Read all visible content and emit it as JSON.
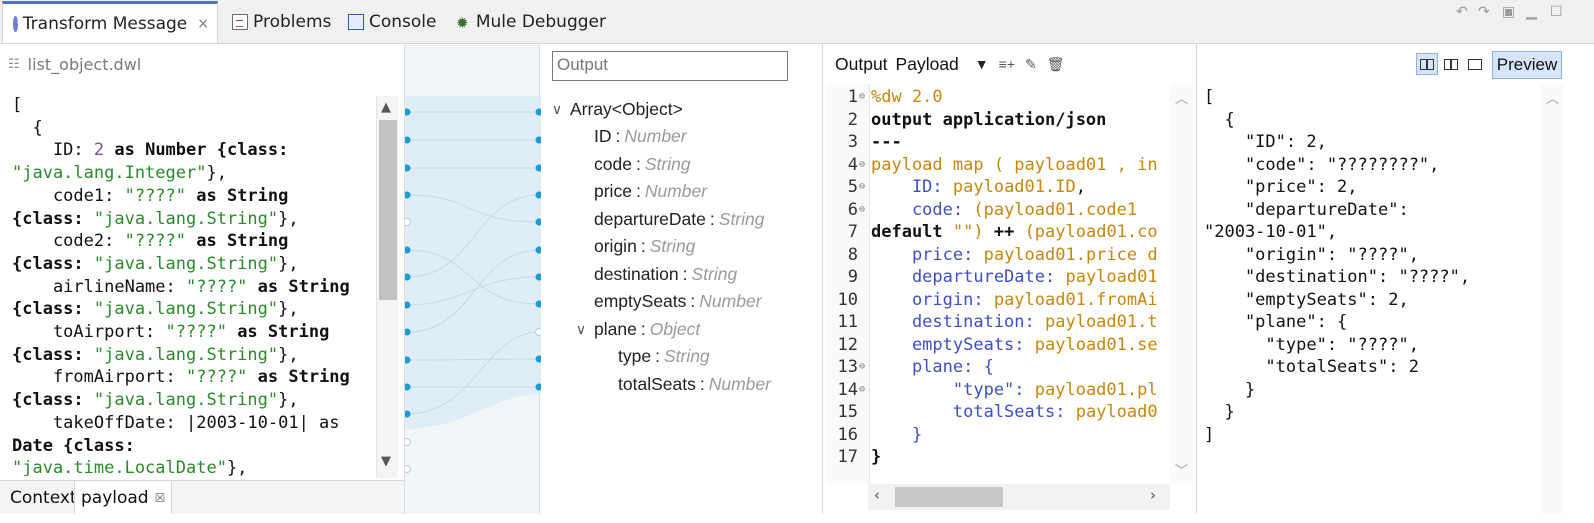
{
  "tabs": [
    {
      "label": "Transform Message",
      "icon": "transform-icon",
      "active": true
    },
    {
      "label": "Problems",
      "icon": "problems-icon"
    },
    {
      "label": "Console",
      "icon": "console-icon"
    },
    {
      "label": "Mule Debugger",
      "icon": "bug-icon"
    }
  ],
  "tab_close": "×",
  "left": {
    "filename": "list_object.dwl",
    "code_lines": [
      [
        [
          "[",
          "plain"
        ]
      ],
      [
        [
          "  {",
          "plain"
        ]
      ],
      [
        [
          "    ID: ",
          "plain"
        ],
        [
          "2",
          "num"
        ],
        [
          " as Number {class:",
          "kw"
        ]
      ],
      [
        [
          "\"java.lang.Integer\"",
          "str"
        ],
        [
          "},",
          "plain"
        ]
      ],
      [
        [
          "    code1: ",
          "plain"
        ],
        [
          "\"????\"",
          "str"
        ],
        [
          " as String",
          "kw"
        ]
      ],
      [
        [
          "{class: ",
          "kw"
        ],
        [
          "\"java.lang.String\"",
          "str"
        ],
        [
          "},",
          "plain"
        ]
      ],
      [
        [
          "    code2: ",
          "plain"
        ],
        [
          "\"????\"",
          "str"
        ],
        [
          " as String",
          "kw"
        ]
      ],
      [
        [
          "{class: ",
          "kw"
        ],
        [
          "\"java.lang.String\"",
          "str"
        ],
        [
          "},",
          "plain"
        ]
      ],
      [
        [
          "    airlineName: ",
          "plain"
        ],
        [
          "\"????\"",
          "str"
        ],
        [
          " as String",
          "kw"
        ]
      ],
      [
        [
          "{class: ",
          "kw"
        ],
        [
          "\"java.lang.String\"",
          "str"
        ],
        [
          "},",
          "plain"
        ]
      ],
      [
        [
          "    toAirport: ",
          "plain"
        ],
        [
          "\"????\"",
          "str"
        ],
        [
          " as String",
          "kw"
        ]
      ],
      [
        [
          "{class: ",
          "kw"
        ],
        [
          "\"java.lang.String\"",
          "str"
        ],
        [
          "},",
          "plain"
        ]
      ],
      [
        [
          "    fromAirport: ",
          "plain"
        ],
        [
          "\"????\"",
          "str"
        ],
        [
          " as String",
          "kw"
        ]
      ],
      [
        [
          "{class: ",
          "kw"
        ],
        [
          "\"java.lang.String\"",
          "str"
        ],
        [
          "},",
          "plain"
        ]
      ],
      [
        [
          "    takeOffDate: |2003-10-01| as",
          "plain"
        ]
      ],
      [
        [
          "Date {class:",
          "kw"
        ]
      ],
      [
        [
          "\"java.time.LocalDate\"",
          "str"
        ],
        [
          "},",
          "plain"
        ]
      ]
    ],
    "bottom_tabs": [
      "Context",
      "payload"
    ],
    "bottom_tab_close": "☒"
  },
  "output": {
    "field_value": "Output",
    "tree": [
      {
        "name": "Array<Object>",
        "type": "",
        "caret": "expanded",
        "indent": 0
      },
      {
        "name": "ID",
        "type": "Number",
        "indent": 1
      },
      {
        "name": "code",
        "type": "String",
        "indent": 1
      },
      {
        "name": "price",
        "type": "Number",
        "indent": 1
      },
      {
        "name": "departureDate",
        "type": "String",
        "indent": 1
      },
      {
        "name": "origin",
        "type": "String",
        "indent": 1
      },
      {
        "name": "destination",
        "type": "String",
        "indent": 1
      },
      {
        "name": "emptySeats",
        "type": "Number",
        "indent": 1
      },
      {
        "name": "plane",
        "type": "Object",
        "caret": "expanded",
        "indent": 1
      },
      {
        "name": "type",
        "type": "String",
        "indent": 2
      },
      {
        "name": "totalSeats",
        "type": "Number",
        "indent": 2
      }
    ]
  },
  "editor": {
    "toolbar_output": "Output",
    "toolbar_target": "Payload",
    "lines": [
      {
        "n": "1",
        "fold": true,
        "parts": [
          [
            "%dw 2.0",
            "orange"
          ]
        ]
      },
      {
        "n": "2",
        "parts": [
          [
            "output application/json",
            "kw"
          ]
        ]
      },
      {
        "n": "3",
        "parts": [
          [
            "---",
            "kw"
          ]
        ]
      },
      {
        "n": "4",
        "fold": true,
        "parts": [
          [
            "payload map ( payload01 , in",
            "orange"
          ]
        ]
      },
      {
        "n": "5",
        "fold": true,
        "parts": [
          [
            "    ID: ",
            "blue"
          ],
          [
            "payload01.ID",
            "orange"
          ],
          [
            ",",
            "plain"
          ]
        ]
      },
      {
        "n": "6",
        "fold": true,
        "parts": [
          [
            "    code: ",
            "blue"
          ],
          [
            "(payload01.code1",
            "orange"
          ]
        ]
      },
      {
        "n": "7",
        "parts": [
          [
            "default ",
            "kw"
          ],
          [
            "\"\")",
            "orange"
          ],
          [
            " ++ ",
            "kw"
          ],
          [
            "(payload01.co",
            "orange"
          ]
        ]
      },
      {
        "n": "8",
        "parts": [
          [
            "    price: ",
            "blue"
          ],
          [
            "payload01.price d",
            "orange"
          ]
        ]
      },
      {
        "n": "9",
        "parts": [
          [
            "    departureDate: ",
            "blue"
          ],
          [
            "payload01",
            "orange"
          ]
        ]
      },
      {
        "n": "10",
        "parts": [
          [
            "    origin: ",
            "blue"
          ],
          [
            "payload01.fromAi",
            "orange"
          ]
        ]
      },
      {
        "n": "11",
        "parts": [
          [
            "    destination: ",
            "blue"
          ],
          [
            "payload01.t",
            "orange"
          ]
        ]
      },
      {
        "n": "12",
        "parts": [
          [
            "    emptySeats: ",
            "blue"
          ],
          [
            "payload01.se",
            "orange"
          ]
        ]
      },
      {
        "n": "13",
        "fold": true,
        "parts": [
          [
            "    plane: {",
            "blue"
          ]
        ]
      },
      {
        "n": "14",
        "fold": true,
        "parts": [
          [
            "        \"type\": ",
            "blue"
          ],
          [
            "payload01.pl",
            "orange"
          ]
        ]
      },
      {
        "n": "15",
        "parts": [
          [
            "        totalSeats: ",
            "blue"
          ],
          [
            "payload0",
            "orange"
          ]
        ]
      },
      {
        "n": "16",
        "parts": [
          [
            "    }",
            "blue"
          ]
        ]
      },
      {
        "n": "17",
        "parts": [
          [
            "}",
            "kw"
          ]
        ]
      }
    ]
  },
  "preview": {
    "button_label": "Preview",
    "lines": [
      "[",
      "  {",
      "    \"ID\": 2,",
      "    \"code\": \"????????\",",
      "    \"price\": 2,",
      "    \"departureDate\":",
      "\"2003-10-01\",",
      "    \"origin\": \"????\",",
      "    \"destination\": \"????\",",
      "    \"emptySeats\": 2,",
      "    \"plane\": {",
      "      \"type\": \"????\",",
      "      \"totalSeats\": 2",
      "    }",
      "  }",
      "]"
    ]
  },
  "colors": {
    "accent": "#4a74c9",
    "string_green": "#2a8a2a",
    "dw_orange": "#c8860d",
    "dw_blue": "#3d4fc8",
    "mapping_dot": "#1a9bd7",
    "mapping_fill": "#d9ebf5"
  }
}
